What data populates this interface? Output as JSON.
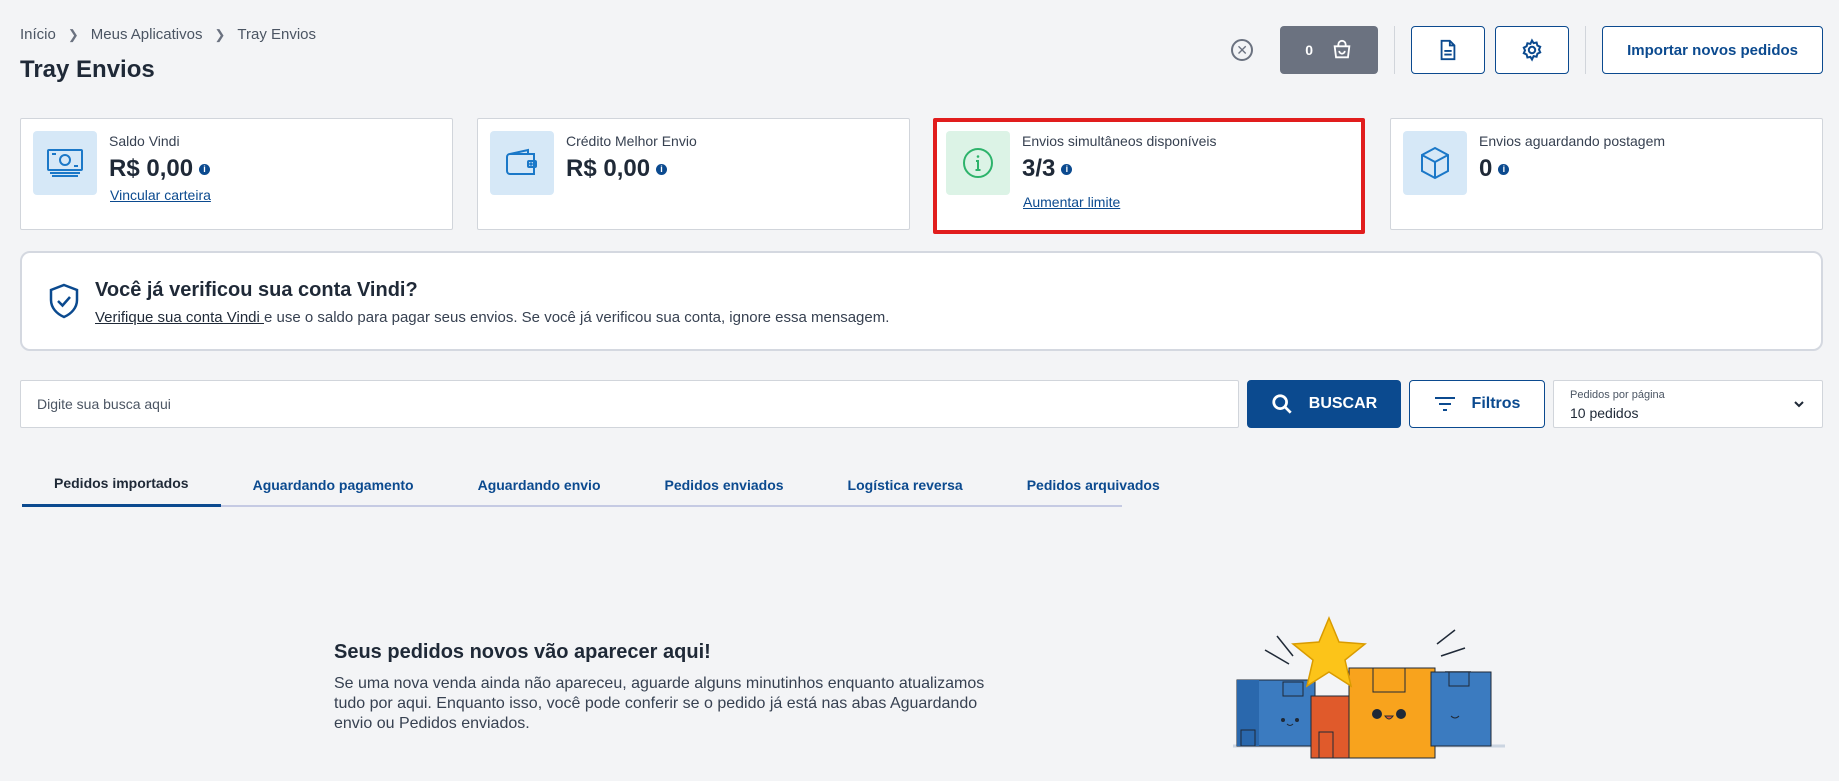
{
  "breadcrumb": {
    "items": [
      "Início",
      "Meus Aplicativos",
      "Tray Envios"
    ]
  },
  "page_title": "Tray Envios",
  "topbar": {
    "cart_count": "0",
    "import_label": "Importar novos pedidos"
  },
  "cards": [
    {
      "label": "Saldo Vindi",
      "value": "R$ 0,00",
      "link": "Vincular carteira",
      "icon": "money-icon"
    },
    {
      "label": "Crédito Melhor Envio",
      "value": "R$ 0,00",
      "icon": "wallet-icon"
    },
    {
      "label": "Envios simultâneos disponíveis",
      "value": "3/3",
      "link": "Aumentar limite",
      "icon": "info-circle-icon"
    },
    {
      "label": "Envios aguardando postagem",
      "value": "0",
      "icon": "box-icon"
    }
  ],
  "verify": {
    "title": "Você já verificou sua conta Vindi?",
    "link": "Verifique sua conta Vindi ",
    "text": "e use o saldo para pagar seus envios. Se você já verificou sua conta, ignore essa mensagem."
  },
  "search": {
    "placeholder": "Digite sua busca aqui",
    "button": "BUSCAR",
    "filter": "Filtros"
  },
  "per_page": {
    "label": "Pedidos por página",
    "value": "10 pedidos"
  },
  "tabs": [
    "Pedidos importados",
    "Aguardando pagamento",
    "Aguardando envio",
    "Pedidos enviados",
    "Logística reversa",
    "Pedidos arquivados"
  ],
  "empty": {
    "title": "Seus pedidos novos vão aparecer aqui!",
    "text": "Se uma nova venda ainda não apareceu, aguarde alguns minutinhos enquanto atualizamos tudo por aqui. Enquanto isso, você pode conferir se o pedido já está nas abas Aguardando envio ou Pedidos enviados."
  },
  "colors": {
    "primary": "#0b4a8f",
    "highlight": "#e11d1d",
    "icon_bg_blue": "#d6e8f7",
    "icon_bg_green": "#dcf3e6",
    "info_green": "#2db36b"
  }
}
